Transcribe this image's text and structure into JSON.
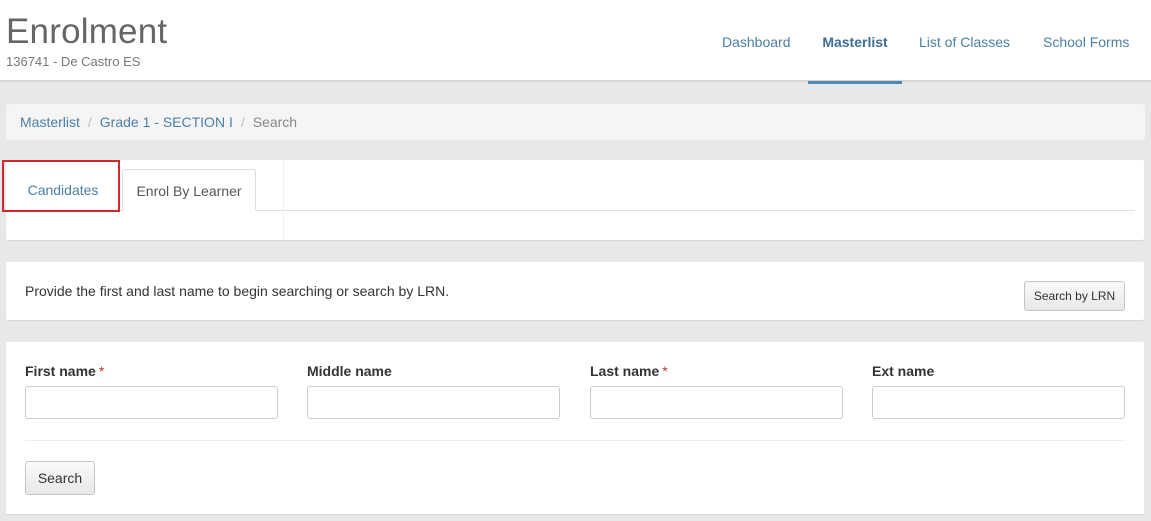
{
  "header": {
    "title": "Enrolment",
    "subtitle": "136741 - De Castro ES"
  },
  "nav": {
    "items": [
      {
        "label": "Dashboard",
        "active": false
      },
      {
        "label": "Masterlist",
        "active": true
      },
      {
        "label": "List of Classes",
        "active": false
      },
      {
        "label": "School Forms",
        "active": false
      }
    ]
  },
  "breadcrumb": {
    "items": [
      "Masterlist",
      "Grade 1 - SECTION I",
      "Search"
    ],
    "separator": "/"
  },
  "tabs": {
    "items": [
      {
        "label": "Candidates",
        "active": false,
        "highlighted": true
      },
      {
        "label": "Enrol By Learner",
        "active": true
      }
    ]
  },
  "info": {
    "text": "Provide the first and last name to begin searching or search by LRN.",
    "search_lrn_label": "Search by LRN"
  },
  "form": {
    "fields": [
      {
        "label": "First name",
        "required": true,
        "value": ""
      },
      {
        "label": "Middle name",
        "required": false,
        "value": ""
      },
      {
        "label": "Last name",
        "required": true,
        "value": ""
      },
      {
        "label": "Ext name",
        "required": false,
        "value": ""
      }
    ],
    "required_marker": "*",
    "search_label": "Search"
  },
  "colors": {
    "link": "#4a7fa8",
    "nav_active_underline": "#4a8ab8",
    "highlight": "#d0282e",
    "required": "#c0392b"
  }
}
